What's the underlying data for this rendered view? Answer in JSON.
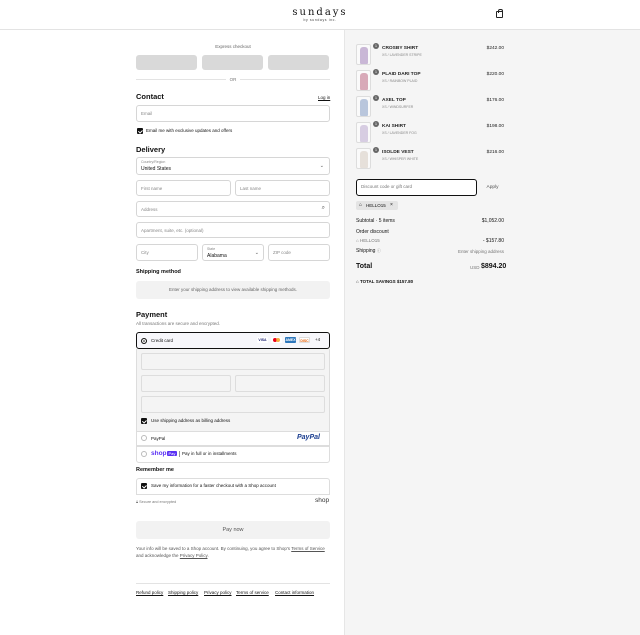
{
  "header": {
    "brand": "sundays",
    "brand_sub": "by sundays inc.",
    "cart_icon": "shopping-bag-icon"
  },
  "express": {
    "label": "Express checkout",
    "or_label": "OR"
  },
  "contact": {
    "heading": "Contact",
    "login_label": "Log in",
    "email_placeholder": "Email",
    "newsletter_label": "Email me with exclusive updates and offers",
    "newsletter_checked": true
  },
  "delivery": {
    "heading": "Delivery",
    "country_label": "Country/Region",
    "country_value": "United States",
    "first_name_placeholder": "First name",
    "last_name_placeholder": "Last name",
    "address_placeholder": "Address",
    "apartment_placeholder": "Apartment, suite, etc. (optional)",
    "city_placeholder": "City",
    "state_label": "State",
    "state_value": "Alabama",
    "zip_placeholder": "ZIP code"
  },
  "shipping_method": {
    "heading": "Shipping method",
    "message": "Enter your shipping address to view available shipping methods."
  },
  "payment": {
    "heading": "Payment",
    "subtitle": "All transactions are secure and encrypted.",
    "credit_card_label": "Credit card",
    "card_brands": [
      "VISA",
      "MC",
      "AMEX",
      "DISC"
    ],
    "card_more": "+4",
    "billing_same_label": "Use shipping address as billing address",
    "billing_same_checked": true,
    "paypal_label": "PayPal",
    "paypal_logo": "PayPal",
    "shoppay_logo": "shop",
    "shoppay_pay": "Pay",
    "shoppay_desc": "Pay in full or in installments"
  },
  "remember": {
    "heading": "Remember me",
    "save_label": "Save my information for a faster checkout with a Shop account",
    "save_checked": true,
    "secure_label": "Secure and encrypted",
    "shop_logo": "shop"
  },
  "pay_now_label": "Pay now",
  "legal": {
    "text_a": "Your info will be saved to a Shop account. By continuing, you agree to Shop's ",
    "terms_link": "Terms of Service",
    "text_b": " and acknowledge the ",
    "privacy_link": "Privacy Policy",
    "text_c": "."
  },
  "footer_links": [
    "Refund policy",
    "Shipping policy",
    "Privacy policy",
    "Terms of service",
    "Contact information"
  ],
  "cart": {
    "items": [
      {
        "name": "CROSBY SHIRT",
        "variant": "XS / LAVENDER STRIPE",
        "price": "$242.00",
        "qty": "1",
        "color": "#c9b7d6"
      },
      {
        "name": "PLAID DARI TOP",
        "variant": "XS / RAINBOW PLAID",
        "price": "$220.00",
        "qty": "1",
        "color": "#d8a9b8"
      },
      {
        "name": "AXEL TOP",
        "variant": "XS / WINDSURFER",
        "price": "$176.00",
        "qty": "1",
        "color": "#b9c6dc"
      },
      {
        "name": "KAI SHIRT",
        "variant": "XS / LAVENDER FOG",
        "price": "$198.00",
        "qty": "1",
        "color": "#d7cde2"
      },
      {
        "name": "ISOLDE VEST",
        "variant": "XS / WHISPER WHITE",
        "price": "$216.00",
        "qty": "1",
        "color": "#e6e0da"
      }
    ],
    "discount_placeholder": "Discount code or gift card",
    "apply_label": "Apply",
    "applied_code": "HELLO15",
    "subtotal_label": "Subtotal · 5 items",
    "subtotal_value": "$1,052.00",
    "order_discount_label": "Order discount",
    "discount_code": "HELLO15",
    "discount_value": "- $157.80",
    "shipping_label": "Shipping",
    "shipping_value": "Enter shipping address",
    "total_label": "Total",
    "currency": "USD",
    "total_value": "$894.20",
    "savings_label": "TOTAL SAVINGS",
    "savings_value": "$157.80"
  }
}
